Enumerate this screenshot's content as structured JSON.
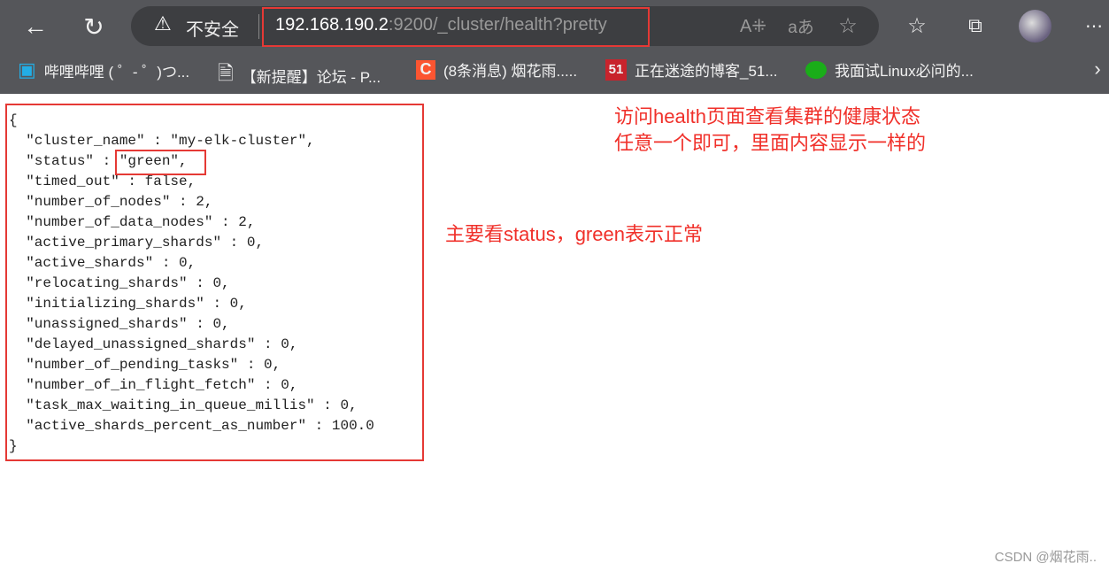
{
  "browser": {
    "security_label": "不安全",
    "url_host": "192.168.190.2",
    "url_rest": ":9200/_cluster/health?pretty",
    "bookmarks": [
      {
        "label": "哔哩哔哩 ( ゜- ゜)つ...",
        "icon": "bilibili-icon"
      },
      {
        "label": "【新提醒】论坛 - P...",
        "icon": "page-icon"
      },
      {
        "label": "(8条消息) 烟花雨.....",
        "icon": "csdn-icon"
      },
      {
        "label": "正在迷途的博客_51...",
        "icon": "51cto-icon"
      },
      {
        "label": "我面试Linux必问的...",
        "icon": "wechat-icon"
      }
    ]
  },
  "json_lines": [
    "{",
    "  ″cluster_name″ : ″my-elk-cluster″,",
    "  ″status″ : ″green″,",
    "  ″timed_out″ : false,",
    "  ″number_of_nodes″ : 2,",
    "  ″number_of_data_nodes″ : 2,",
    "  ″active_primary_shards″ : 0,",
    "  ″active_shards″ : 0,",
    "  ″relocating_shards″ : 0,",
    "  ″initializing_shards″ : 0,",
    "  ″unassigned_shards″ : 0,",
    "  ″delayed_unassigned_shards″ : 0,",
    "  ″number_of_pending_tasks″ : 0,",
    "  ″number_of_in_flight_fetch″ : 0,",
    "  ″task_max_waiting_in_queue_millis″ : 0,",
    "  ″active_shards_percent_as_number″ : 100.0",
    "}"
  ],
  "annotations": {
    "note1_line1": "访问health页面查看集群的健康状态",
    "note1_line2": "任意一个即可，里面内容显示一样的",
    "note2": "主要看status，green表示正常",
    "color": "#f0302a"
  },
  "watermark": "CSDN @烟花雨.."
}
